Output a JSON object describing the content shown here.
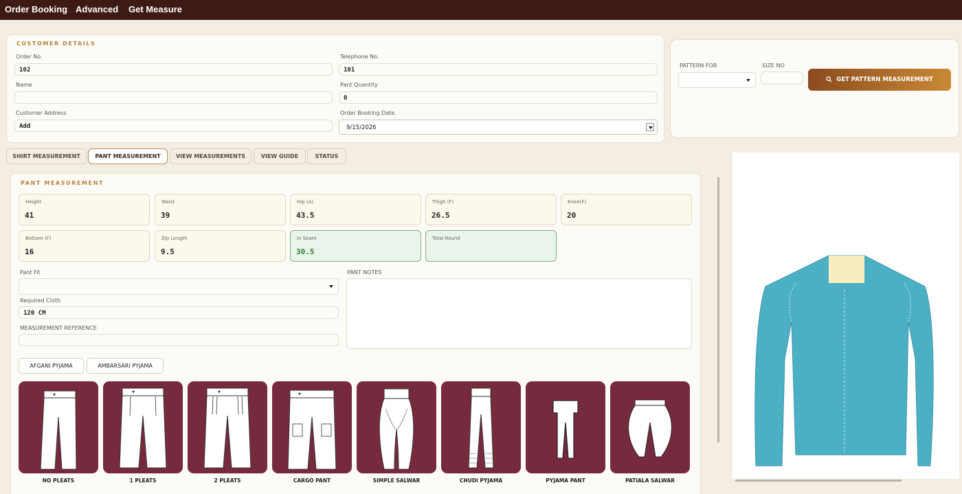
{
  "menu": [
    "Order Booking",
    "Advanced",
    "Get Measure"
  ],
  "customer": {
    "title": "CUSTOMER DETAILS",
    "order_no_label": "Order No.",
    "order_no": "102",
    "telephone_label": "Telephone No.",
    "telephone": "101",
    "name_label": "Name",
    "name": "",
    "pant_qty_label": "Pant Quantity",
    "pant_qty": "0",
    "address_label": "Customer Address",
    "address": "Add",
    "booking_date_label": "Order Booking Date.",
    "booking_date": "9/15/2026"
  },
  "pattern": {
    "pattern_for_label": "PATTERN FOR",
    "pattern_for": "",
    "size_no_label": "SIZE NO",
    "size_no": "",
    "button": "GET PATTERN MEASUREMENT",
    "button_icon": "search-icon"
  },
  "tabs": [
    "SHIRT MEASUREMENT",
    "PANT MEASUREMENT",
    "VIEW MEASUREMENTS",
    "VIEW GUIDE",
    "STATUS"
  ],
  "active_tab": "PANT MEASUREMENT",
  "pant": {
    "title": "PANT MEASUREMENT",
    "measurements": [
      {
        "label": "Height",
        "value": "41"
      },
      {
        "label": "Waist",
        "value": "39"
      },
      {
        "label": "Hip (A)",
        "value": "43.5"
      },
      {
        "label": "Thigh (F)",
        "value": "26.5"
      },
      {
        "label": "Knee(F)",
        "value": "20"
      },
      {
        "label": "Bottom (F)",
        "value": "16"
      },
      {
        "label": "Zip Length",
        "value": "9.5"
      },
      {
        "label": "In Seam",
        "value": "30.5"
      },
      {
        "label": "Total Round",
        "value": ""
      }
    ],
    "pant_fit_label": "Pant Fit",
    "pant_fit": "",
    "required_cloth_label": "Required Cloth",
    "required_cloth": "120 CM",
    "measurement_ref_label": "MEASUREMENT REFERENCE",
    "measurement_ref": "",
    "notes_label": "PANT NOTES",
    "notes": ""
  },
  "pyjama_buttons": [
    "AFGANI PYJAMA",
    "AMBARSARI PYJAMA"
  ],
  "styles": [
    "NO PLEATS",
    "1 PLEATS",
    "2 PLEATS",
    "CARGO PANT",
    "SIMPLE SALWAR",
    "CHUDI PYJAMA",
    "PYJAMA PANT",
    "PATIALA SALWAR"
  ],
  "colors": {
    "topbar": "#3e1a14",
    "accent": "#b5833f",
    "style_card": "#772a3e",
    "shirt": "#4cb0c5",
    "collar": "#f6eec1",
    "highlight": "#7fae83"
  }
}
